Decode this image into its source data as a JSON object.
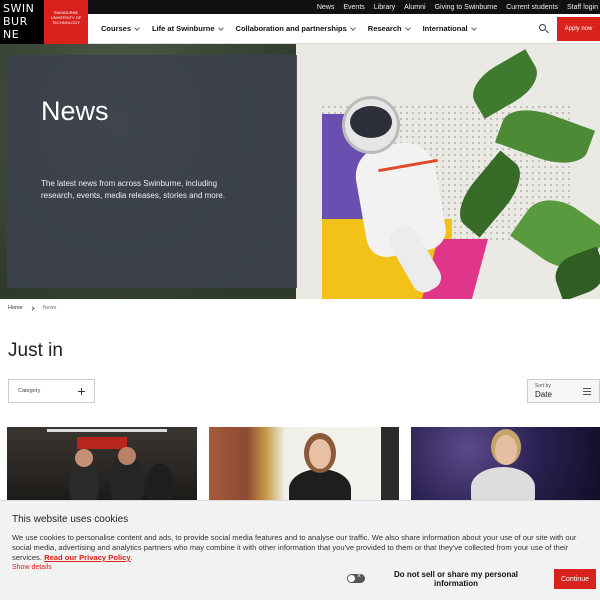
{
  "logo": {
    "lines": [
      "SWIN",
      "BUR",
      "NE"
    ],
    "tagline": "SWINBURNE UNIVERSITY OF TECHNOLOGY"
  },
  "utility_nav": [
    "News",
    "Events",
    "Library",
    "Alumni",
    "Giving to Swinburne",
    "Current students",
    "Staff login"
  ],
  "main_nav": [
    "Courses",
    "Life at Swinburne",
    "Collaboration and partnerships",
    "Research",
    "International"
  ],
  "apply_label": "Apply now",
  "hero": {
    "title": "News",
    "description": "The latest news from across Swinburne, including research, events, media releases, stories and more."
  },
  "breadcrumb": {
    "home": "Home",
    "current": "News"
  },
  "section_title": "Just in",
  "filters": {
    "category_label": "Category",
    "sort_label": "Sort by",
    "sort_value": "Date"
  },
  "cookie": {
    "title": "This website uses cookies",
    "text": "We use cookies to personalise content and ads, to provide social media features and to analyse our traffic. We also share information about your use of our site with our social media, advertising and analytics partners who may combine it with other information that you've provided to them or that they've collected from your use of their services.",
    "privacy_link": "Read our Privacy Policy",
    "show_details": "Show details",
    "do_not_sell": "Do not sell or share my personal information",
    "continue": "Continue"
  },
  "colors": {
    "brand_red": "#d9221c",
    "panel": "#3c404e"
  }
}
